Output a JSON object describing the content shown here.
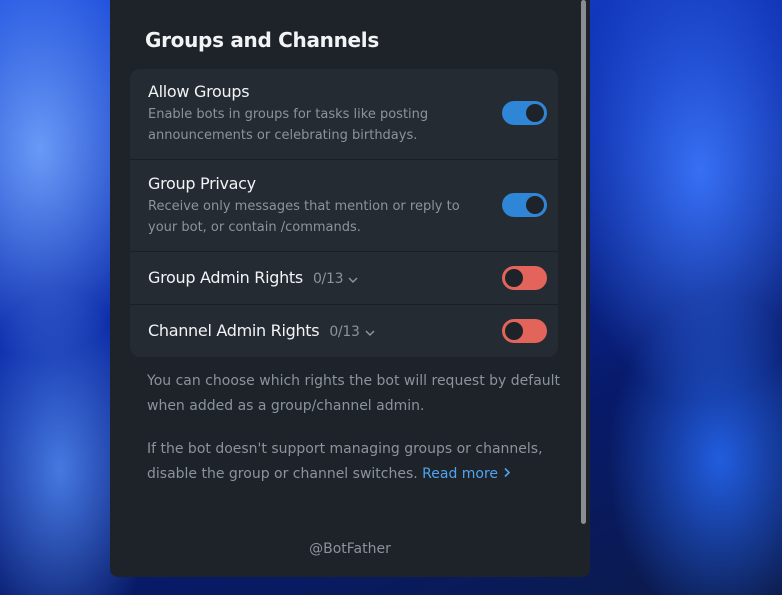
{
  "title": "Groups and Channels",
  "settings": {
    "allow_groups": {
      "label": "Allow Groups",
      "description": "Enable bots in groups for tasks like posting announcements or celebrating birthdays.",
      "enabled": true
    },
    "group_privacy": {
      "label": "Group Privacy",
      "description": "Receive only messages that mention or reply to your bot, or contain /commands.",
      "enabled": true
    },
    "group_admin_rights": {
      "label": "Group Admin Rights",
      "count": "0/13",
      "enabled": false
    },
    "channel_admin_rights": {
      "label": "Channel Admin Rights",
      "count": "0/13",
      "enabled": false
    }
  },
  "notes": {
    "rights_note": "You can choose which rights the bot will request by default when added as a group/channel admin.",
    "support_note": "If the bot doesn't support managing groups or channels, disable the group or channel switches.",
    "read_more": "Read more"
  },
  "footer": "@BotFather",
  "colors": {
    "toggle_on": "#2f86d6",
    "toggle_off": "#e2645a",
    "link": "#4fa3ef"
  }
}
